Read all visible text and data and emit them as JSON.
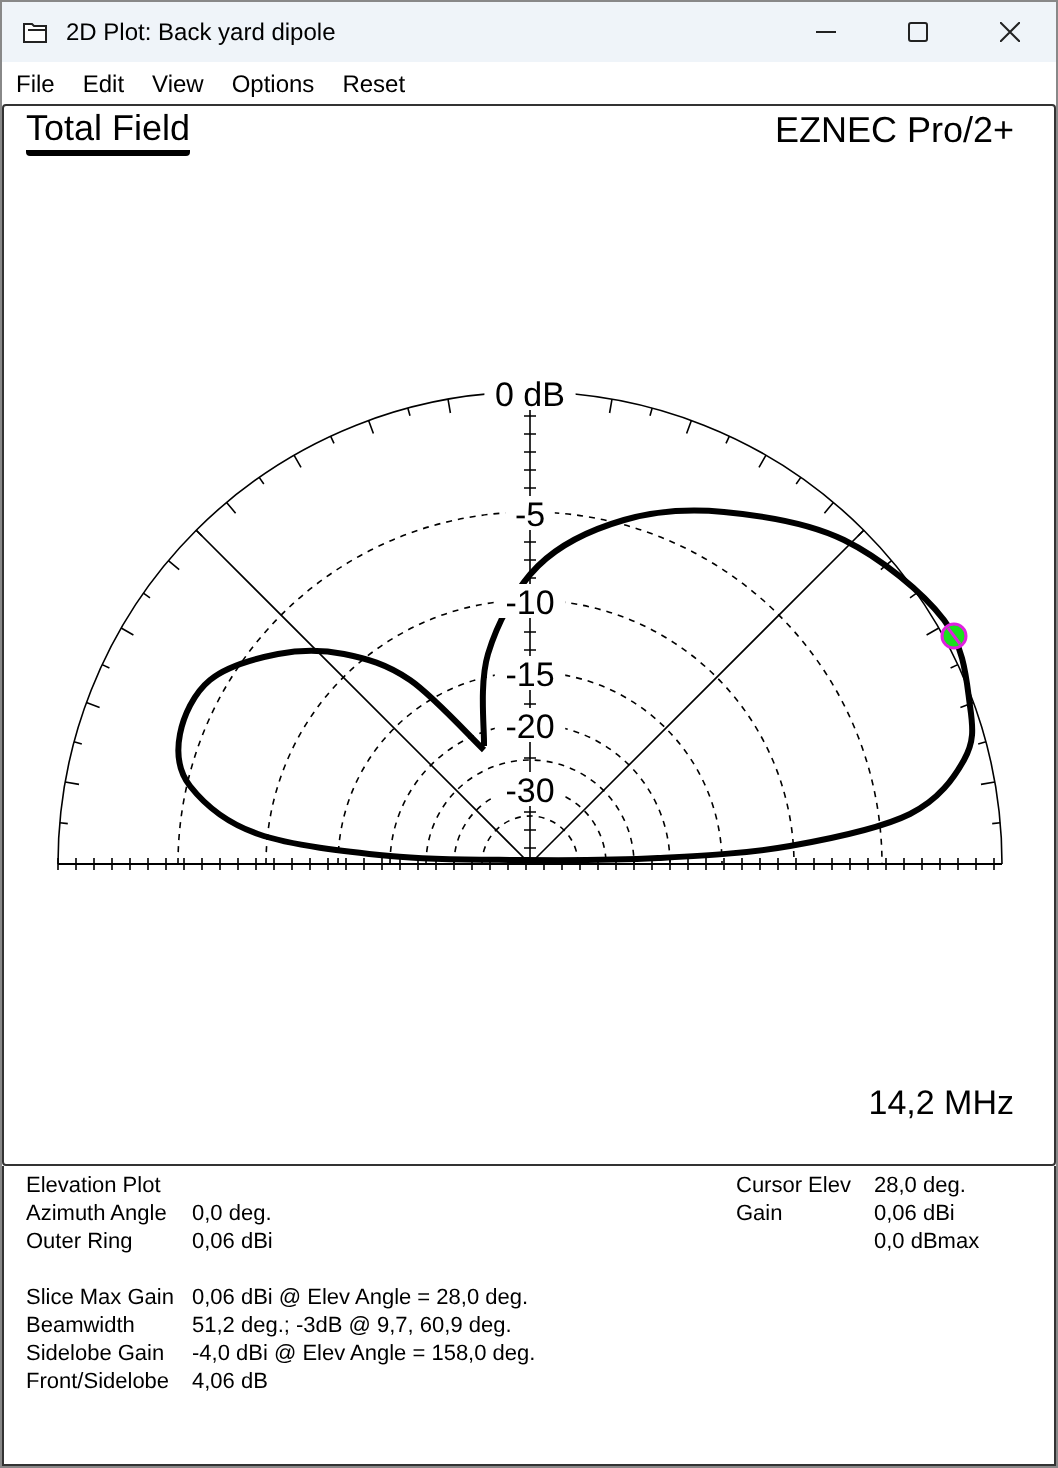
{
  "window": {
    "title": "2D Plot: Back yard dipole"
  },
  "menu": [
    "File",
    "Edit",
    "View",
    "Options",
    "Reset"
  ],
  "plot": {
    "title": "Total Field",
    "brand": "EZNEC Pro/2+",
    "frequency": "14,2 MHz",
    "ring_labels": [
      "0 dB",
      "-5",
      "-10",
      "-15",
      "-20",
      "-30"
    ]
  },
  "info_left": [
    [
      {
        "label": "Elevation Plot"
      },
      {
        "label": "Azimuth Angle",
        "value": "0,0 deg."
      },
      {
        "label": "Outer Ring",
        "value": "0,06 dBi"
      }
    ],
    [
      {
        "label": "Slice Max Gain",
        "value": "0,06 dBi @ Elev Angle = 28,0 deg."
      },
      {
        "label": "Beamwidth",
        "value": "51,2 deg.; -3dB @ 9,7, 60,9 deg."
      },
      {
        "label": "Sidelobe Gain",
        "value": "-4,0 dBi @ Elev Angle = 158,0 deg."
      },
      {
        "label": "Front/Sidelobe",
        "value": "4,06 dB"
      }
    ]
  ],
  "info_right": [
    {
      "label": "Cursor Elev",
      "value": "28,0 deg."
    },
    {
      "label": "Gain",
      "value": "0,06 dBi"
    },
    {
      "value": "0,0 dBmax"
    }
  ]
}
